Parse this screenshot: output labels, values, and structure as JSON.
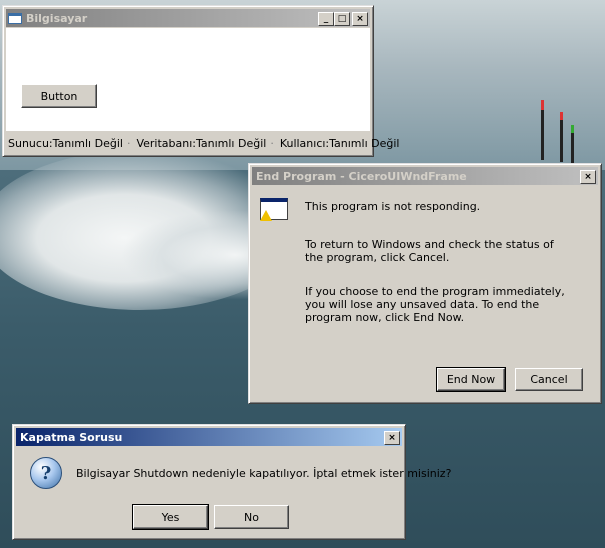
{
  "bilgisayar": {
    "title": "Bilgisayar",
    "button_label": "Button",
    "status": [
      "Sunucu:Tanımlı Değil",
      "Veritabanı:Tanımlı Değil",
      "Kullanıcı:Tanımlı Değil"
    ],
    "controls": {
      "minimize": "_",
      "maximize": "□",
      "close": "×"
    }
  },
  "end_program": {
    "title": "End Program - CiceroUIWndFrame",
    "message1": "This program is not responding.",
    "message2": "To return to Windows and check the status of the program, click Cancel.",
    "message3": "If you choose to end the program immediately, you will lose any unsaved data. To end the program now, click End Now.",
    "end_now_label": "End Now",
    "cancel_label": "Cancel",
    "close": "×"
  },
  "kapatma": {
    "title": "Kapatma Sorusu",
    "message": "Bilgisayar Shutdown nedeniyle kapatılıyor. İptal etmek ister misiniz?",
    "yes_label": "Yes",
    "no_label": "No",
    "close": "×"
  }
}
